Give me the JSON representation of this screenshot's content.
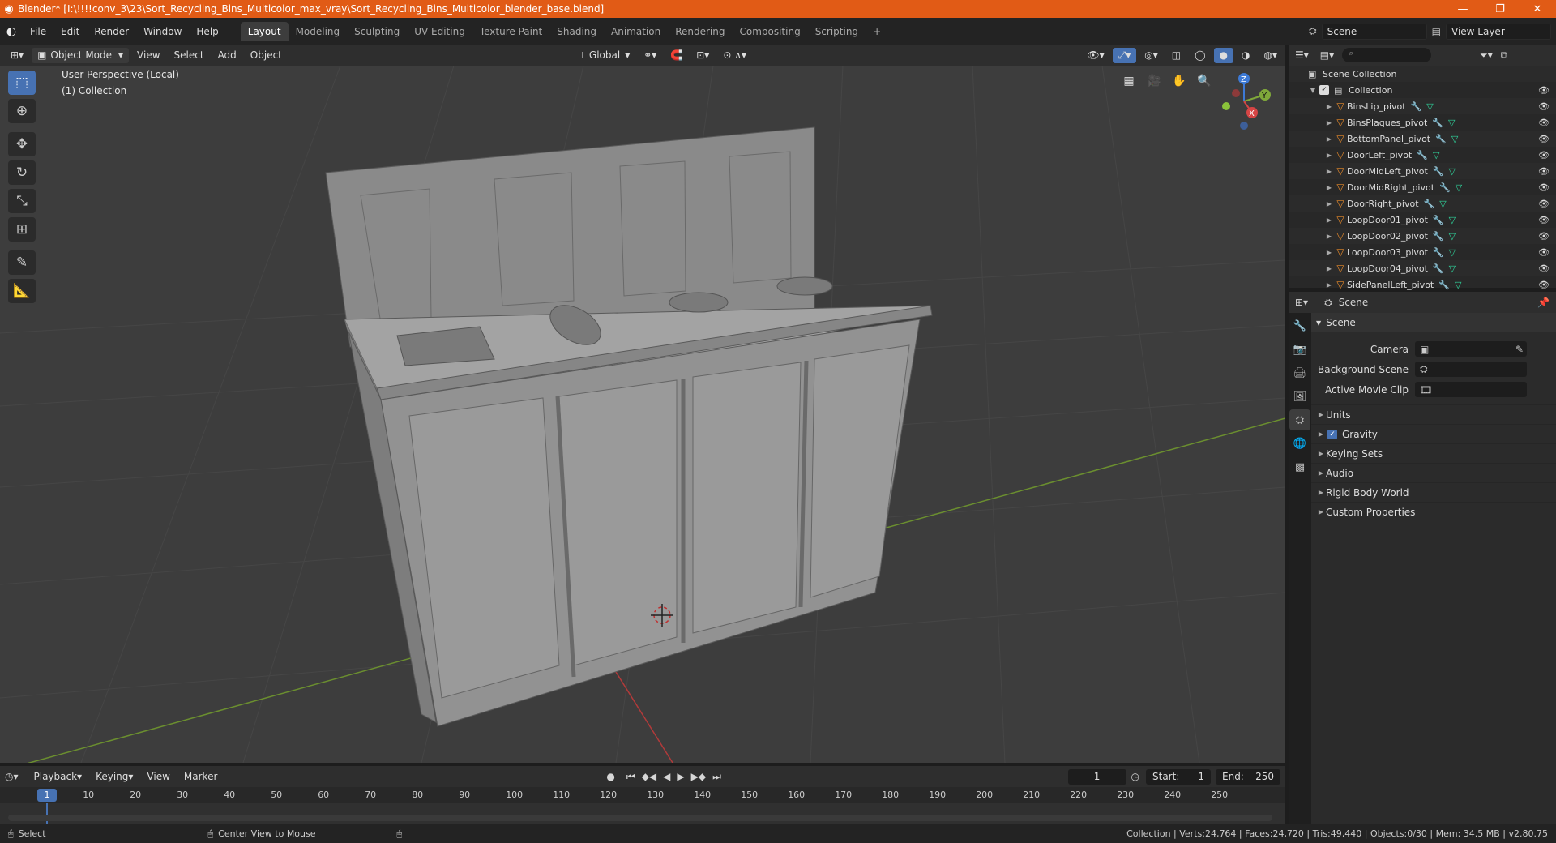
{
  "window": {
    "title": "Blender* [I:\\!!!!conv_3\\23\\Sort_Recycling_Bins_Multicolor_max_vray\\Sort_Recycling_Bins_Multicolor_blender_base.blend]",
    "minimize": "—",
    "maximize": "❐",
    "close": "✕"
  },
  "menu": {
    "items": [
      "File",
      "Edit",
      "Render",
      "Window",
      "Help"
    ]
  },
  "workspaces": [
    "Layout",
    "Modeling",
    "Sculpting",
    "UV Editing",
    "Texture Paint",
    "Shading",
    "Animation",
    "Rendering",
    "Compositing",
    "Scripting"
  ],
  "workspace_add": "+",
  "scene_selector": "Scene",
  "view_layer_selector": "View Layer",
  "viewport_header": {
    "mode": "Object Mode",
    "view": "View",
    "select": "Select",
    "add": "Add",
    "object": "Object",
    "orientation": "Global"
  },
  "viewport_info": {
    "line1": "User Perspective (Local)",
    "line2": "(1) Collection"
  },
  "gizmo": {
    "z": "Z",
    "y": "Y",
    "x": "X"
  },
  "outliner": {
    "root": "Scene Collection",
    "collection": "Collection",
    "items": [
      "BinsLip_pivot",
      "BinsPlaques_pivot",
      "BottomPanel_pivot",
      "DoorLeft_pivot",
      "DoorMidLeft_pivot",
      "DoorMidRight_pivot",
      "DoorRight_pivot",
      "LoopDoor01_pivot",
      "LoopDoor02_pivot",
      "LoopDoor03_pivot",
      "LoopDoor04_pivot",
      "SidePanelLeft_pivot"
    ]
  },
  "properties": {
    "context": "Scene",
    "panel_title": "Scene",
    "fields": [
      {
        "label": "Camera",
        "value": ""
      },
      {
        "label": "Background Scene",
        "value": ""
      },
      {
        "label": "Active Movie Clip",
        "value": ""
      }
    ],
    "subpanels": [
      "Units",
      "Gravity",
      "Keying Sets",
      "Audio",
      "Rigid Body World",
      "Custom Properties"
    ]
  },
  "timeline": {
    "menus": [
      "Playback",
      "Keying",
      "View",
      "Marker"
    ],
    "current_frame": "1",
    "start_label": "Start:",
    "start": "1",
    "end_label": "End:",
    "end": "250",
    "ruler": [
      "1",
      "10",
      "20",
      "30",
      "40",
      "50",
      "60",
      "70",
      "80",
      "90",
      "100",
      "110",
      "120",
      "130",
      "140",
      "150",
      "160",
      "170",
      "180",
      "190",
      "200",
      "210",
      "220",
      "230",
      "240",
      "250"
    ]
  },
  "status": {
    "left": "Select",
    "middle": "Center View to Mouse",
    "right": "Collection | Verts:24,764 | Faces:24,720 | Tris:49,440 | Objects:0/30 | Mem: 34.5 MB | v2.80.75"
  }
}
